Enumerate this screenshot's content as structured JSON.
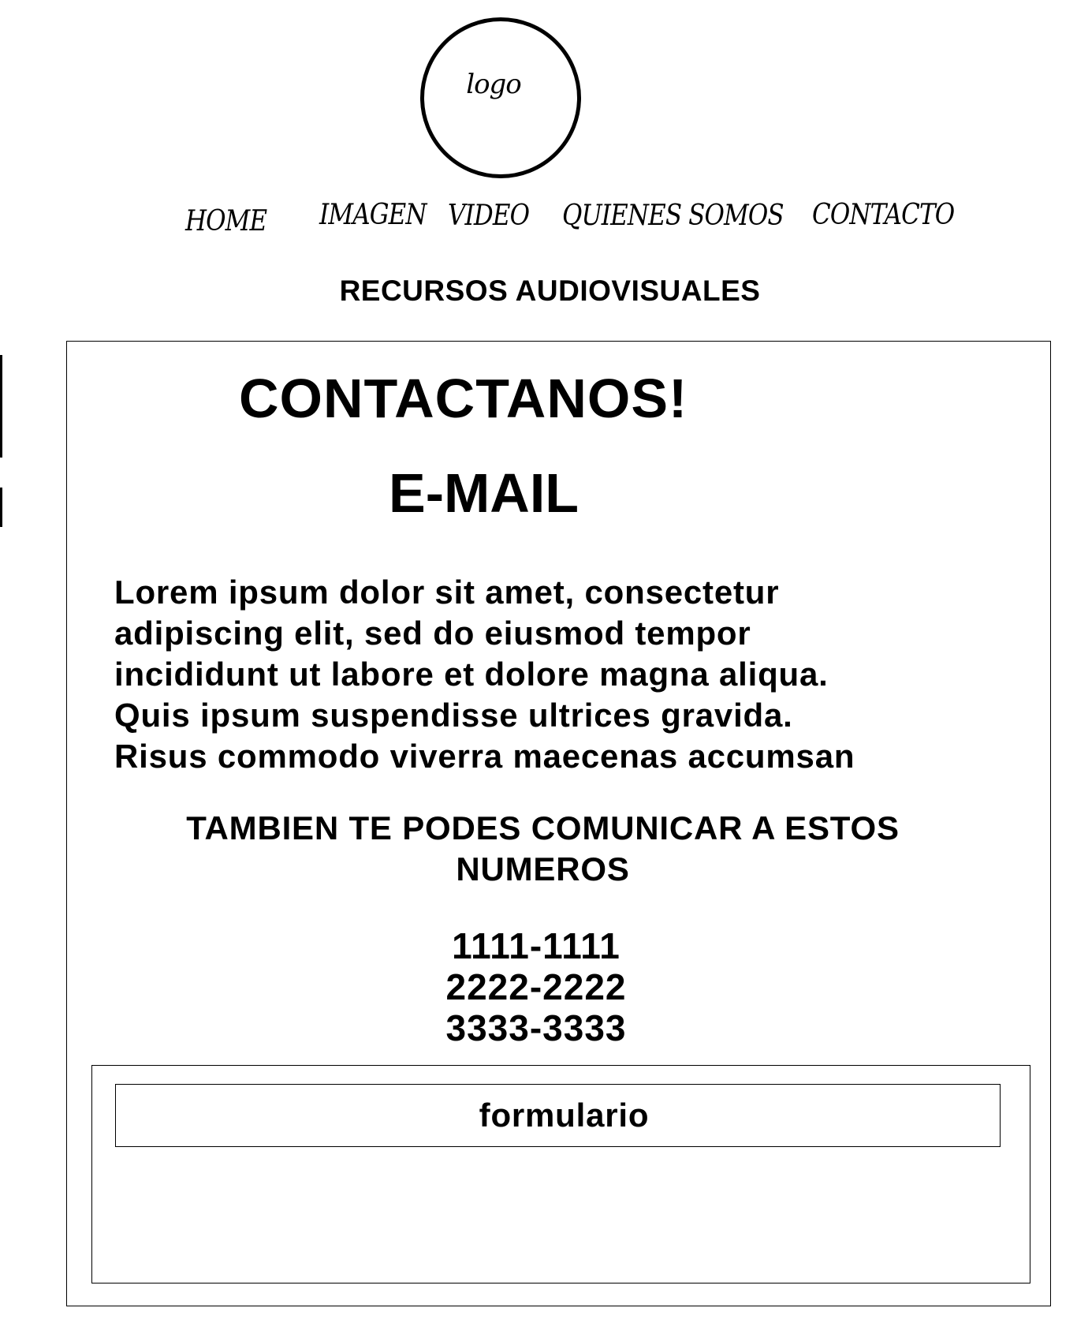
{
  "header": {
    "logo_text": "logo",
    "nav": [
      {
        "label": "HOME"
      },
      {
        "label": "IMAGEN"
      },
      {
        "label": "VIDEO"
      },
      {
        "label": "QUIENES SOMOS"
      },
      {
        "label": "CONTACTO"
      }
    ],
    "site_title": "RECURSOS AUDIOVISUALES"
  },
  "main": {
    "heading": "CONTACTANOS!",
    "email_heading": "E-MAIL",
    "paragraph_lines": [
      "Lorem ipsum dolor sit amet, consectetur",
      "adipiscing elit, sed do eiusmod tempor",
      "incididunt ut labore et dolore magna aliqua.",
      "Quis ipsum suspendisse ultrices gravida.",
      "Risus commodo viverra maecenas accumsan"
    ],
    "also_contact": "TAMBIEN TE PODES COMUNICAR A ESTOS NUMEROS",
    "phones": [
      "1111-1111",
      "2222-2222",
      "3333-3333"
    ],
    "form_label": "formulario"
  }
}
